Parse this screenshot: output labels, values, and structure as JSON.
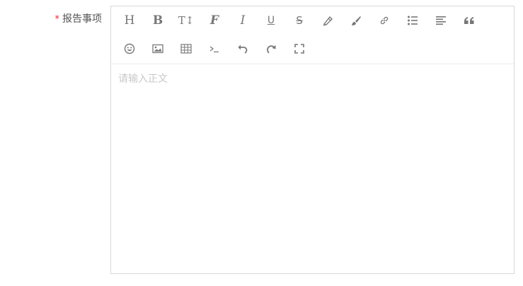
{
  "form": {
    "required_mark": "*",
    "label": "报告事项"
  },
  "toolbar": {
    "row1": [
      {
        "name": "heading-icon",
        "glyph": "H"
      },
      {
        "name": "bold-icon",
        "glyph": "B"
      },
      {
        "name": "font-size-icon",
        "glyph": "T↕"
      },
      {
        "name": "font-family-icon",
        "glyph": "F"
      },
      {
        "name": "italic-icon",
        "glyph": "I"
      },
      {
        "name": "underline-icon",
        "glyph": "U"
      },
      {
        "name": "strikethrough-icon",
        "glyph": "S"
      },
      {
        "name": "text-color-icon"
      },
      {
        "name": "background-color-icon"
      },
      {
        "name": "link-icon"
      },
      {
        "name": "list-icon"
      },
      {
        "name": "justify-icon"
      },
      {
        "name": "quote-icon"
      }
    ],
    "row2": [
      {
        "name": "emoticon-icon"
      },
      {
        "name": "image-icon"
      },
      {
        "name": "table-icon"
      },
      {
        "name": "code-icon"
      },
      {
        "name": "undo-icon"
      },
      {
        "name": "redo-icon"
      },
      {
        "name": "fullscreen-icon"
      }
    ]
  },
  "editor": {
    "placeholder": "请输入正文"
  }
}
